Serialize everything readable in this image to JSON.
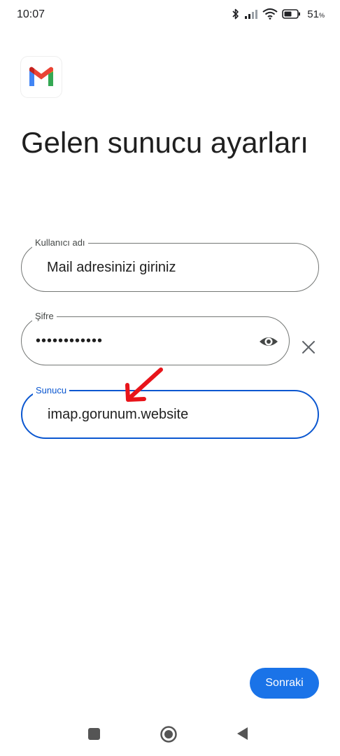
{
  "status_bar": {
    "time": "10:07",
    "battery_percent": "51",
    "battery_unit": "%"
  },
  "app": {
    "logo_icon": "gmail-logo",
    "title": "Gelen sunucu ayarları"
  },
  "form": {
    "username": {
      "label": "Kullanıcı adı",
      "value": "Mail adresinizi giriniz"
    },
    "password": {
      "label": "Şifre",
      "value": "••••••••••••",
      "toggle_icon": "eye-icon",
      "clear_icon": "close-icon"
    },
    "server": {
      "label": "Sunucu",
      "value": "imap.gorunum.website"
    }
  },
  "annotation": {
    "arrow_color": "#e8141a"
  },
  "actions": {
    "next_label": "Sonraki",
    "accent_color": "#1a73e8"
  },
  "navigation": {
    "recents_icon": "square-icon",
    "home_icon": "circle-icon",
    "back_icon": "triangle-back-icon"
  }
}
